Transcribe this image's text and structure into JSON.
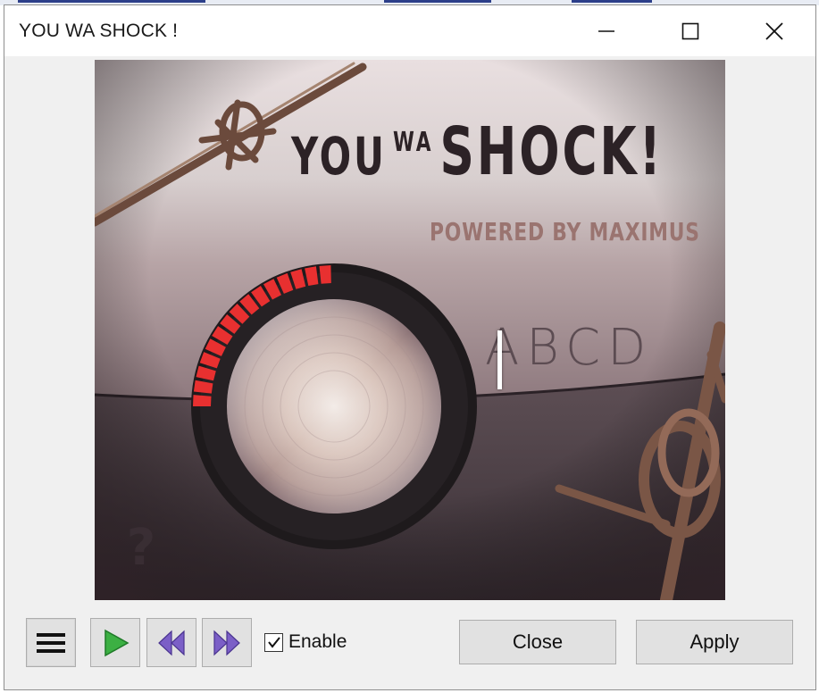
{
  "window": {
    "title": "YOU WA SHOCK !",
    "caption_buttons": [
      "minimize",
      "maximize",
      "close"
    ]
  },
  "artwork": {
    "title_you": "YOU",
    "title_wa": "WA",
    "title_shock": "SHOCK!",
    "subtitle": "POWERED BY MAXIMUS",
    "knob_label": "ABCD",
    "help_glyph": "?",
    "knob_level": 0.25,
    "colors": {
      "meter": "#e83030",
      "knob_face": "#d9c0b8",
      "ring": "#1e1a1c"
    }
  },
  "toolbar": {
    "menu_icon": "hamburger-icon",
    "play_icon": "play-icon",
    "prev_icon": "rewind-icon",
    "next_icon": "fast-forward-icon",
    "enable_label": "Enable",
    "enable_checked": true,
    "close_label": "Close",
    "apply_label": "Apply",
    "colors": {
      "play": "#3cb043",
      "skip": "#7b5fc7"
    }
  }
}
